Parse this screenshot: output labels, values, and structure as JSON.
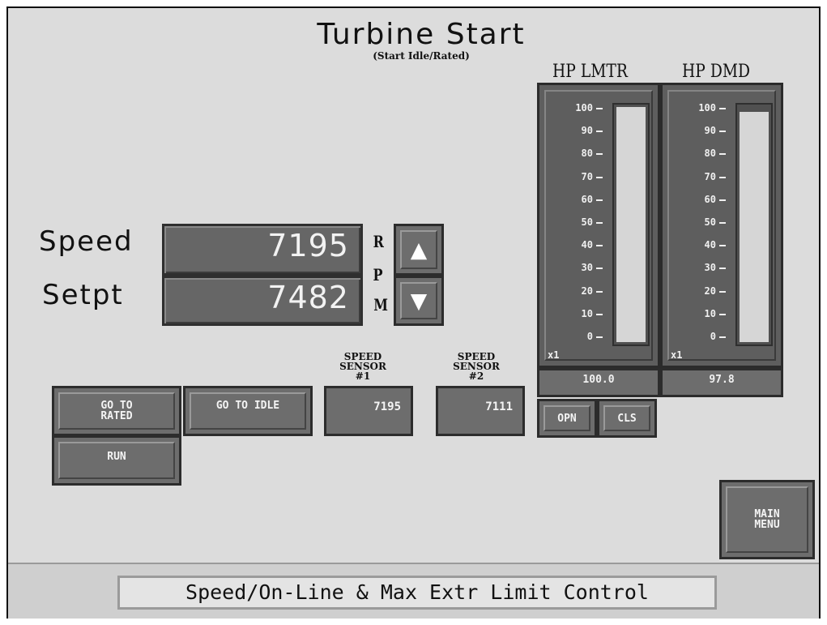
{
  "header": {
    "title": "Turbine Start",
    "subtitle": "(Start Idle/Rated)"
  },
  "speed_panel": {
    "speed_label": "Speed",
    "speed_value": "7195",
    "setpoint_label": "Setpt",
    "setpoint_value": "7482",
    "rpm_letters": [
      "R",
      "P",
      "M"
    ],
    "up_arrow": "▲",
    "down_arrow": "▼"
  },
  "buttons": {
    "go_to_rated": "GO TO\nRATED",
    "go_to_idle": "GO TO IDLE",
    "run": "RUN",
    "opn": "OPN",
    "cls": "CLS",
    "main_menu": "MAIN\nMENU"
  },
  "sensors": [
    {
      "label": "SPEED\nSENSOR\n#1",
      "value": "7195"
    },
    {
      "label": "SPEED\nSENSOR\n#2",
      "value": "7111"
    }
  ],
  "gauges": [
    {
      "title": "HP LMTR",
      "scale": "x1",
      "readout": "100.0",
      "level_percent": 100
    },
    {
      "title": "HP DMD",
      "scale": "x1",
      "readout": "97.8",
      "level_percent": 97.8
    }
  ],
  "gauge_ticks": [
    "100",
    "90",
    "80",
    "70",
    "60",
    "50",
    "40",
    "30",
    "20",
    "10",
    "0"
  ],
  "status_bar": {
    "text": "Speed/On-Line & Max Extr Limit Control"
  },
  "icons": {
    "up": "arrow-up-icon",
    "down": "arrow-down-icon"
  },
  "colors": {
    "background": "#dcdcdc",
    "panel_dark": "#666666",
    "bar_fill": "#d6d6d6"
  }
}
